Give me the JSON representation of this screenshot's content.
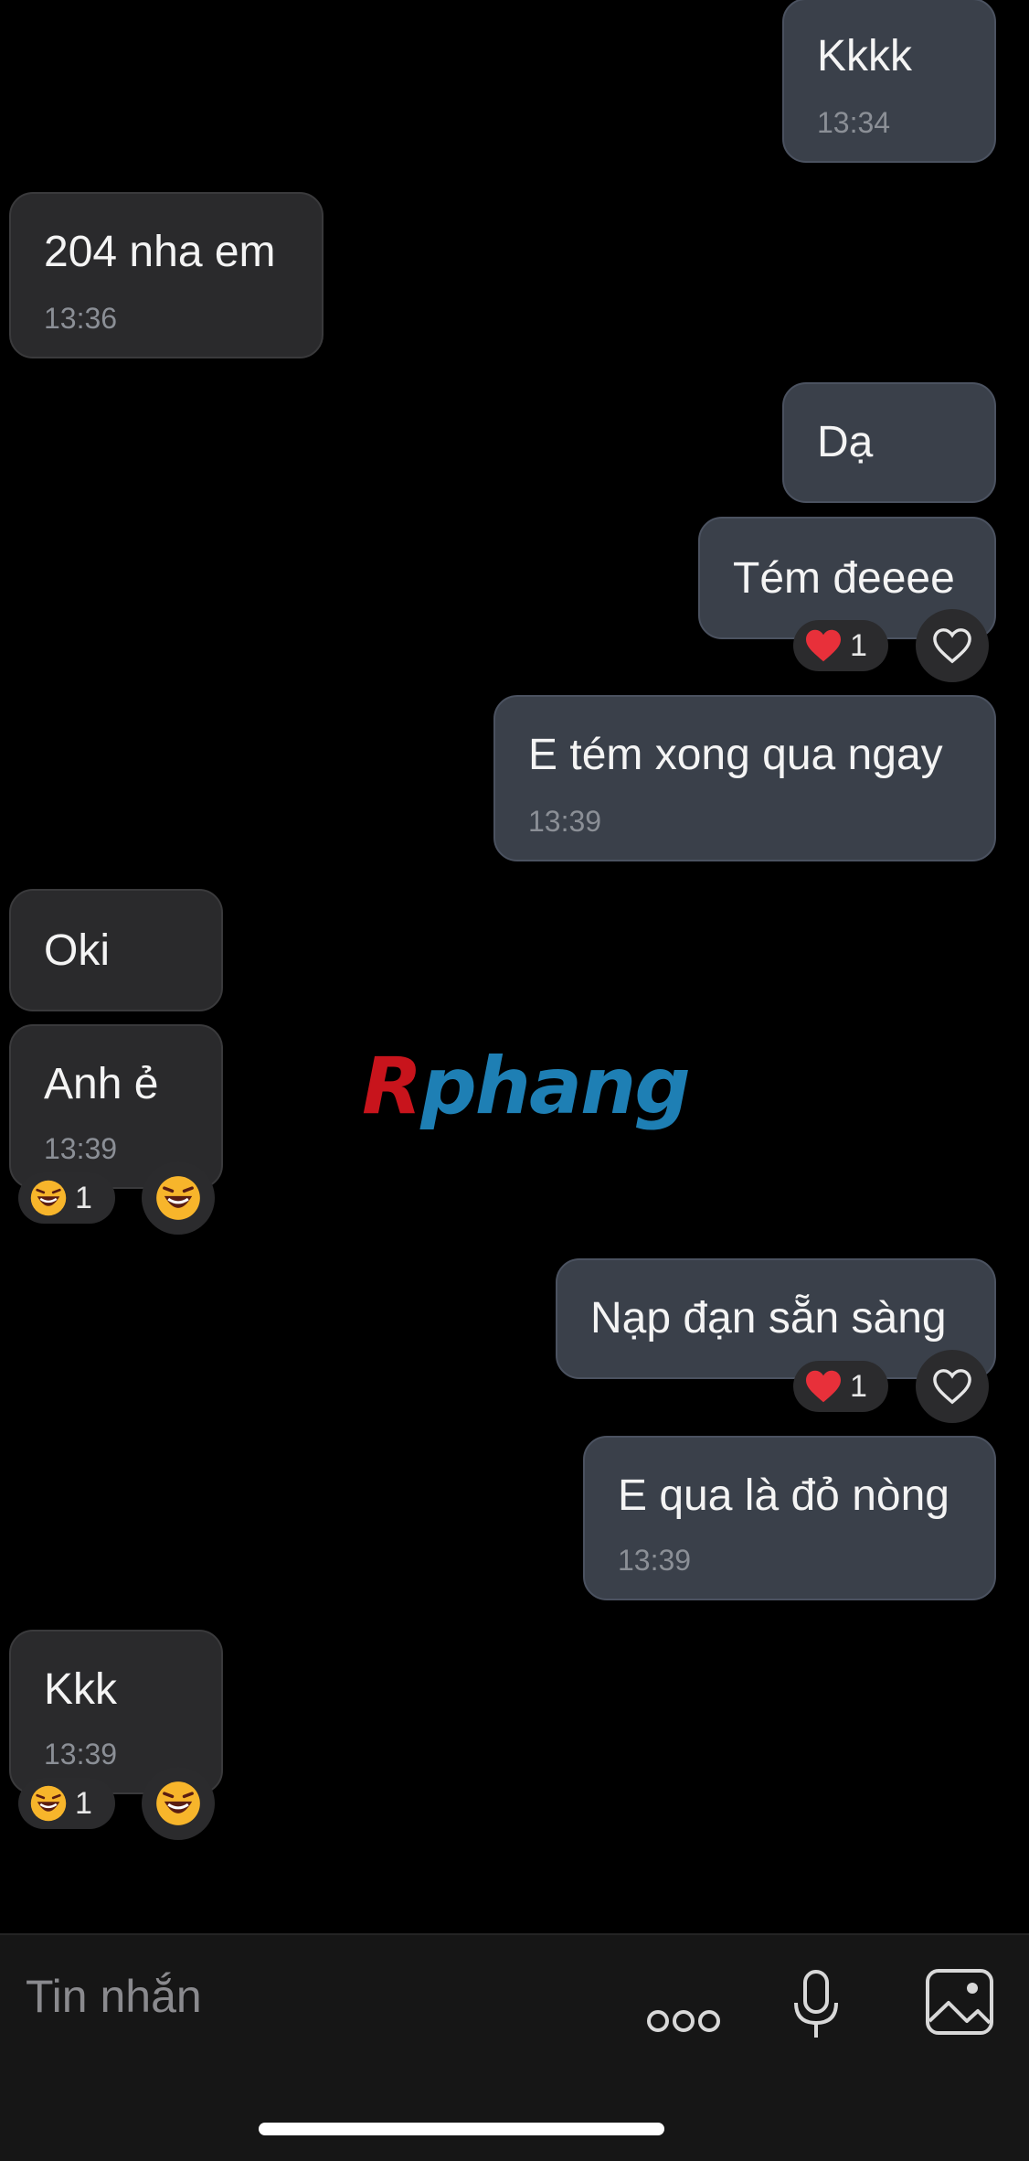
{
  "colors": {
    "background": "#000000",
    "incoming_bubble": "#2a2a2c",
    "outgoing_bubble": "#3a404a",
    "timestamp": "#8b8f96",
    "composer": "#161616"
  },
  "messages": [
    {
      "direction": "outgoing",
      "text": "Kkkk",
      "time": "13:34"
    },
    {
      "direction": "incoming",
      "text": "204 nha em",
      "time": "13:36"
    },
    {
      "direction": "outgoing",
      "text": "Dạ"
    },
    {
      "direction": "outgoing",
      "text": "Tém đeeee",
      "reaction": {
        "emoji": "heart-emoji",
        "count": "1"
      }
    },
    {
      "direction": "outgoing",
      "text": "E tém xong qua ngay",
      "time": "13:39"
    },
    {
      "direction": "incoming",
      "text": "Oki"
    },
    {
      "direction": "incoming",
      "text": "Anh ẻ",
      "time": "13:39",
      "reaction": {
        "emoji": "laughing-emoji",
        "count": "1"
      }
    },
    {
      "direction": "outgoing",
      "text": "Nạp đạn sẵn sàng",
      "reaction": {
        "emoji": "heart-emoji",
        "count": "1"
      }
    },
    {
      "direction": "outgoing",
      "text": "E qua là đỏ nòng",
      "time": "13:39"
    },
    {
      "direction": "incoming",
      "text": "Kkk",
      "time": "13:39",
      "reaction": {
        "emoji": "laughing-emoji",
        "count": "1"
      }
    }
  ],
  "watermark": {
    "first": "R",
    "rest": "phang"
  },
  "composer": {
    "placeholder": "Tin nhắn",
    "icons": [
      "more-options-icon",
      "microphone-icon",
      "image-icon"
    ]
  }
}
